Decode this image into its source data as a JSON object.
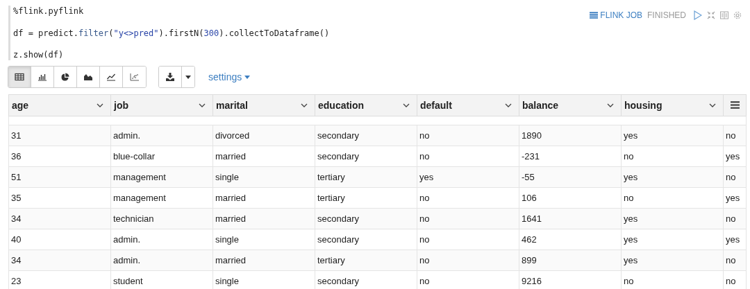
{
  "paragraph": {
    "code_lines": [
      [
        {
          "kind": "plain",
          "text": "%flink.pyflink"
        }
      ],
      [
        {
          "kind": "plain",
          "text": "df = predict."
        },
        {
          "kind": "name",
          "text": "filter"
        },
        {
          "kind": "plain",
          "text": "("
        },
        {
          "kind": "string",
          "text": "\"y<>pred\""
        },
        {
          "kind": "plain",
          "text": ").firstN("
        },
        {
          "kind": "number",
          "text": "300"
        },
        {
          "kind": "plain",
          "text": ").collectToDataframe()"
        }
      ],
      [
        {
          "kind": "plain",
          "text": "z.show(df)"
        }
      ]
    ],
    "job_link": "FLINK JOB",
    "status": "FINISHED"
  },
  "toolbar": {
    "view_buttons": [
      {
        "kind": "table",
        "selected": true
      },
      {
        "kind": "bar",
        "selected": false
      },
      {
        "kind": "pie",
        "selected": false
      },
      {
        "kind": "area",
        "selected": false
      },
      {
        "kind": "line",
        "selected": false
      },
      {
        "kind": "scatter",
        "selected": false
      }
    ],
    "settings": "settings"
  },
  "table": {
    "columns": [
      "age",
      "job",
      "marital",
      "education",
      "default",
      "balance",
      "housing"
    ],
    "rows": [
      [
        "31",
        "admin.",
        "divorced",
        "secondary",
        "no",
        "1890",
        "yes",
        "no"
      ],
      [
        "36",
        "blue-collar",
        "married",
        "secondary",
        "no",
        "-231",
        "no",
        "yes"
      ],
      [
        "51",
        "management",
        "single",
        "tertiary",
        "yes",
        "-55",
        "yes",
        "no"
      ],
      [
        "35",
        "management",
        "married",
        "tertiary",
        "no",
        "106",
        "no",
        "yes"
      ],
      [
        "34",
        "technician",
        "married",
        "secondary",
        "no",
        "1641",
        "yes",
        "no"
      ],
      [
        "40",
        "admin.",
        "single",
        "secondary",
        "no",
        "462",
        "yes",
        "yes"
      ],
      [
        "34",
        "admin.",
        "married",
        "tertiary",
        "no",
        "899",
        "yes",
        "no"
      ],
      [
        "23",
        "student",
        "single",
        "secondary",
        "no",
        "9216",
        "no",
        "no"
      ]
    ]
  }
}
